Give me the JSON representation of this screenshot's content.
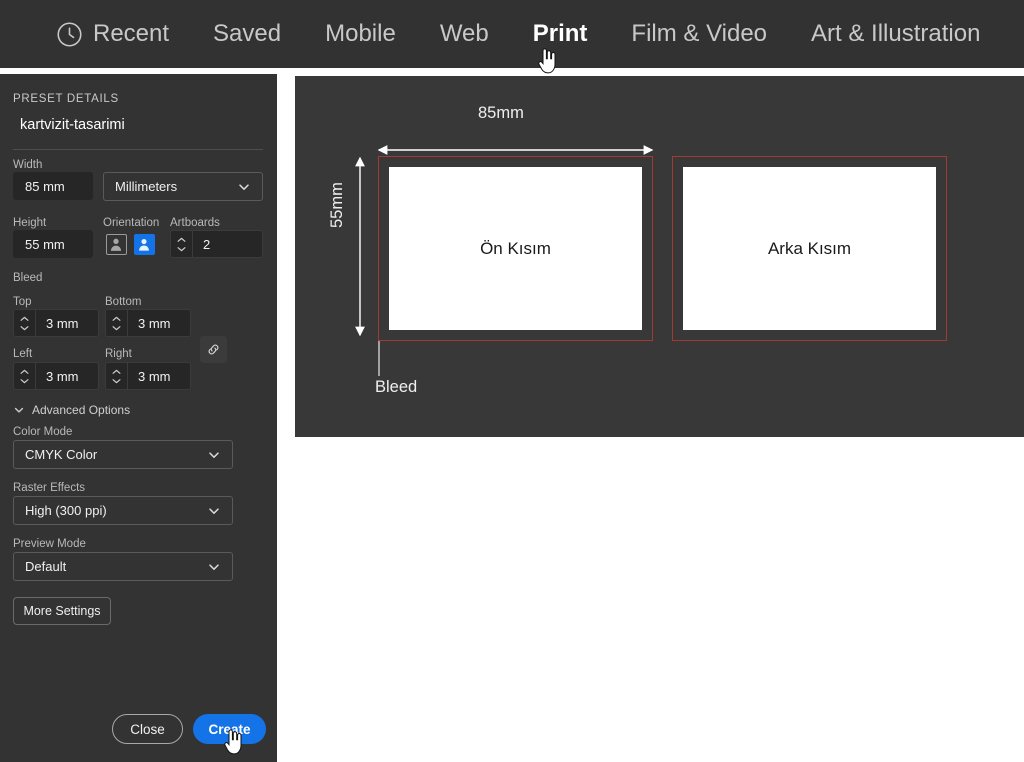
{
  "topnav": {
    "items": [
      {
        "label": "Recent",
        "icon": "clock-icon",
        "active": false
      },
      {
        "label": "Saved",
        "icon": null,
        "active": false
      },
      {
        "label": "Mobile",
        "icon": null,
        "active": false
      },
      {
        "label": "Web",
        "icon": null,
        "active": false
      },
      {
        "label": "Print",
        "icon": null,
        "active": true
      },
      {
        "label": "Film & Video",
        "icon": null,
        "active": false
      },
      {
        "label": "Art & Illustration",
        "icon": null,
        "active": false
      }
    ],
    "cursor_icon": "hand-pointer-cursor"
  },
  "panel": {
    "section_title": "PRESET DETAILS",
    "preset_name": "kartvizit-tasarimi",
    "width": {
      "label": "Width",
      "value": "85 mm"
    },
    "units": {
      "value": "Millimeters",
      "chevron_icon": "chevron-down-icon"
    },
    "height": {
      "label": "Height",
      "value": "55 mm"
    },
    "orientation": {
      "label": "Orientation",
      "portrait_icon": "portrait-orientation-icon",
      "landscape_icon": "landscape-orientation-icon",
      "selected": "landscape"
    },
    "artboards": {
      "label": "Artboards",
      "value": "2"
    },
    "bleed": {
      "label": "Bleed",
      "top": {
        "label": "Top",
        "value": "3 mm"
      },
      "bottom": {
        "label": "Bottom",
        "value": "3 mm"
      },
      "left": {
        "label": "Left",
        "value": "3 mm"
      },
      "right": {
        "label": "Right",
        "value": "3 mm"
      },
      "link_icon": "chain-link-icon"
    },
    "advanced_options": {
      "label": "Advanced Options",
      "chevron_icon": "chevron-down-icon"
    },
    "color_mode": {
      "label": "Color Mode",
      "value": "CMYK Color",
      "chevron_icon": "chevron-down-icon"
    },
    "raster_effects": {
      "label": "Raster Effects",
      "value": "High (300 ppi)",
      "chevron_icon": "chevron-down-icon"
    },
    "preview_mode": {
      "label": "Preview Mode",
      "value": "Default",
      "chevron_icon": "chevron-down-icon"
    },
    "more_settings": "More Settings",
    "close_button": "Close",
    "create_button": "Create",
    "create_cursor_icon": "hand-pointer-cursor"
  },
  "preview": {
    "width_dimension": "85mm",
    "height_dimension": "55mm",
    "bleed_callout": "Bleed",
    "artboards": [
      {
        "label": "Ön Kısım"
      },
      {
        "label": "Arka Kısım"
      }
    ]
  },
  "colors": {
    "accent": "#1473e6",
    "panel_bg": "#333333",
    "nav_bg": "#323232",
    "preview_bg": "#383838",
    "bleed_line": "#a03a32",
    "artboard": "#ffffff"
  }
}
